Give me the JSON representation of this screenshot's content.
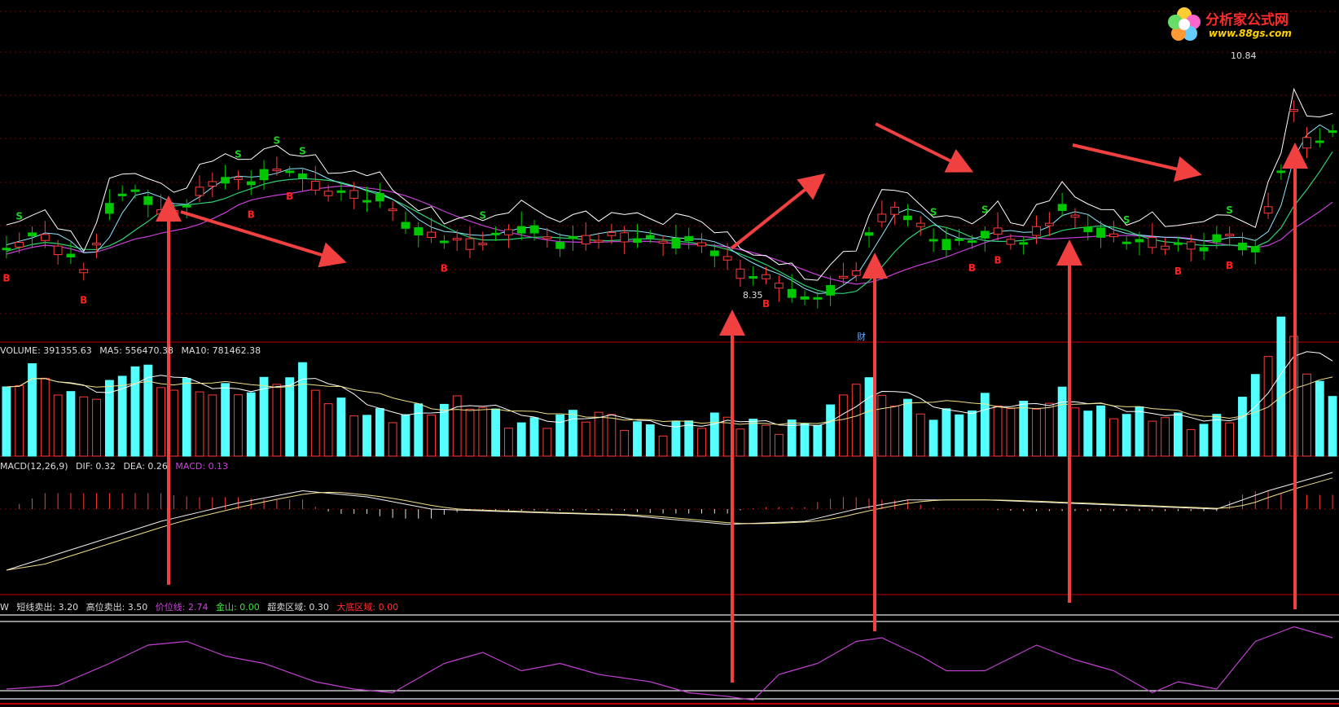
{
  "colors": {
    "up": "#ff3b3b",
    "down": "#00c800",
    "vol_down": "#54ffff",
    "ma_white": "#ffffff",
    "ma_cyan": "#8fe8ff",
    "ma_magenta": "#c840d8",
    "ma_green": "#2fd070",
    "signal_buy": "#ff2020",
    "signal_sell": "#20d020",
    "arrow": "#f04040",
    "grid": "#7a0000",
    "macd_dif": "#f0f0f0",
    "macd_dea": "#f0e08c",
    "osc": "#c040d0"
  },
  "logo": {
    "name": "分析家公式网",
    "url": "www.88gs.com"
  },
  "price_panel": {
    "high_label": "10.84",
    "low_label": "8.35",
    "fin_badge": "财"
  },
  "volume_panel": {
    "label": "VOLUME: 391355.63",
    "ma5": "MA5: 556470.38",
    "ma10": "MA10: 781462.38"
  },
  "macd_panel": {
    "label": "MACD(12,26,9)",
    "dif": "DIF: 0.32",
    "dea": "DEA: 0.26",
    "macd": "MACD: 0.13"
  },
  "osc_panel": {
    "name": "W",
    "s1": "短线卖出: 3.20",
    "s2": "高位卖出: 3.50",
    "s3": "价位线: 2.74",
    "s4": "金山: 0.00",
    "s5": "超卖区域: 0.30",
    "s6": "大底区域: 0.00"
  },
  "chart_data": {
    "type": "candlestick",
    "n": 104,
    "price_anchors": [
      [
        0,
        8.8
      ],
      [
        2,
        9.0
      ],
      [
        5,
        8.8
      ],
      [
        6,
        8.6
      ],
      [
        8,
        9.3
      ],
      [
        10,
        9.5
      ],
      [
        12,
        9.2
      ],
      [
        14,
        9.3
      ],
      [
        16,
        9.6
      ],
      [
        19,
        9.6
      ],
      [
        22,
        9.7
      ],
      [
        24,
        9.5
      ],
      [
        29,
        9.4
      ],
      [
        32,
        9.0
      ],
      [
        36,
        8.9
      ],
      [
        40,
        9.1
      ],
      [
        43,
        8.9
      ],
      [
        48,
        9.0
      ],
      [
        54,
        8.9
      ],
      [
        57,
        8.6
      ],
      [
        60,
        8.5
      ],
      [
        62,
        8.3
      ],
      [
        64,
        8.4
      ],
      [
        66,
        8.6
      ],
      [
        67,
        9.0
      ],
      [
        69,
        9.3
      ],
      [
        70,
        9.2
      ],
      [
        73,
        8.9
      ],
      [
        77,
        9.0
      ],
      [
        79,
        8.9
      ],
      [
        82,
        9.3
      ],
      [
        85,
        9.0
      ],
      [
        88,
        8.9
      ],
      [
        93,
        8.9
      ],
      [
        95,
        9.0
      ],
      [
        97,
        8.8
      ],
      [
        99,
        9.7
      ],
      [
        100,
        10.3
      ],
      [
        101,
        10.0
      ],
      [
        103,
        10.1
      ]
    ],
    "ma_white_offset": 0.12,
    "volume_anchors": [
      [
        0,
        0.9
      ],
      [
        2,
        1.1
      ],
      [
        5,
        0.8
      ],
      [
        8,
        1.0
      ],
      [
        10,
        1.3
      ],
      [
        12,
        0.9
      ],
      [
        15,
        0.9
      ],
      [
        20,
        1.0
      ],
      [
        23,
        1.1
      ],
      [
        25,
        0.7
      ],
      [
        30,
        0.6
      ],
      [
        33,
        0.6
      ],
      [
        36,
        0.7
      ],
      [
        40,
        0.5
      ],
      [
        45,
        0.5
      ],
      [
        50,
        0.45
      ],
      [
        55,
        0.45
      ],
      [
        58,
        0.4
      ],
      [
        60,
        0.45
      ],
      [
        62,
        0.5
      ],
      [
        64,
        0.6
      ],
      [
        66,
        1.0
      ],
      [
        68,
        0.8
      ],
      [
        70,
        0.7
      ],
      [
        73,
        0.6
      ],
      [
        76,
        0.7
      ],
      [
        79,
        0.6
      ],
      [
        82,
        0.9
      ],
      [
        85,
        0.6
      ],
      [
        88,
        0.5
      ],
      [
        93,
        0.5
      ],
      [
        95,
        0.6
      ],
      [
        97,
        1.0
      ],
      [
        99,
        1.8
      ],
      [
        101,
        1.2
      ],
      [
        103,
        0.8
      ]
    ],
    "macd_dif_anchors": [
      [
        0,
        -1.0
      ],
      [
        6,
        -0.6
      ],
      [
        12,
        -0.2
      ],
      [
        18,
        0.1
      ],
      [
        23,
        0.3
      ],
      [
        28,
        0.2
      ],
      [
        33,
        0.0
      ],
      [
        40,
        -0.05
      ],
      [
        48,
        -0.1
      ],
      [
        56,
        -0.25
      ],
      [
        62,
        -0.2
      ],
      [
        66,
        0.0
      ],
      [
        70,
        0.15
      ],
      [
        76,
        0.15
      ],
      [
        82,
        0.1
      ],
      [
        88,
        0.05
      ],
      [
        94,
        0.0
      ],
      [
        98,
        0.3
      ],
      [
        103,
        0.6
      ]
    ],
    "osc_anchors": [
      [
        0,
        0.1
      ],
      [
        4,
        0.15
      ],
      [
        8,
        0.45
      ],
      [
        11,
        0.7
      ],
      [
        14,
        0.75
      ],
      [
        17,
        0.55
      ],
      [
        20,
        0.45
      ],
      [
        24,
        0.2
      ],
      [
        27,
        0.1
      ],
      [
        30,
        0.05
      ],
      [
        34,
        0.45
      ],
      [
        37,
        0.6
      ],
      [
        40,
        0.35
      ],
      [
        43,
        0.45
      ],
      [
        46,
        0.3
      ],
      [
        50,
        0.2
      ],
      [
        53,
        0.05
      ],
      [
        56,
        0.0
      ],
      [
        58,
        -0.05
      ],
      [
        60,
        0.3
      ],
      [
        63,
        0.45
      ],
      [
        66,
        0.75
      ],
      [
        68,
        0.8
      ],
      [
        71,
        0.55
      ],
      [
        73,
        0.35
      ],
      [
        76,
        0.35
      ],
      [
        80,
        0.7
      ],
      [
        83,
        0.5
      ],
      [
        86,
        0.35
      ],
      [
        89,
        0.05
      ],
      [
        91,
        0.2
      ],
      [
        94,
        0.1
      ],
      [
        97,
        0.75
      ],
      [
        100,
        0.95
      ],
      [
        103,
        0.8
      ]
    ],
    "buy_signals": [
      0,
      6,
      19,
      22,
      34,
      59,
      75,
      77,
      91,
      95
    ],
    "sell_signals": [
      1,
      18,
      21,
      23,
      37,
      72,
      76,
      87,
      95
    ],
    "indicator_levels": {
      "short_sell": 3.2,
      "high_sell": 3.5,
      "price_line": 2.74,
      "gold": 0.0,
      "oversold": 0.3,
      "bottom": 0.0
    }
  }
}
